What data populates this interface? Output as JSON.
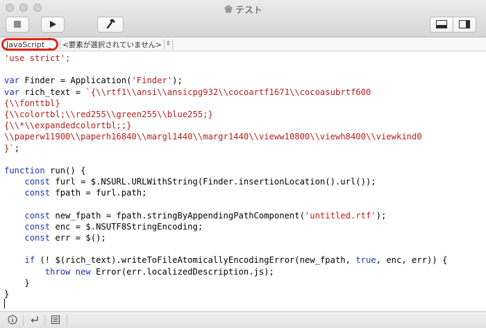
{
  "window": {
    "title": "テスト"
  },
  "navigator": {
    "language": "JavaScript",
    "element": "<要素が選択されていません>"
  },
  "colors": {
    "keyword": "#1b36b4",
    "string": "#b6201a",
    "highlight_ring": "#e2231a"
  },
  "toolbar": {
    "stop_icon": "stop-icon",
    "run_icon": "play-icon",
    "compile_icon": "hammer-icon",
    "view_icons": [
      "split-bottom-icon",
      "split-right-icon"
    ]
  },
  "bottombar": {
    "icons": [
      "info-icon",
      "return-icon",
      "list-icon"
    ]
  },
  "editor": {
    "lines": [
      [
        {
          "t": "'use strict';",
          "c": "str"
        }
      ],
      [],
      [
        {
          "t": "var",
          "c": "kw"
        },
        {
          "t": " Finder = Application("
        },
        {
          "t": "'Finder'",
          "c": "str"
        },
        {
          "t": ");"
        }
      ],
      [
        {
          "t": "var",
          "c": "kw"
        },
        {
          "t": " rich_text = "
        },
        {
          "t": "`{\\\\rtf1\\\\ansi\\\\ansicpg932\\\\cocoartf1671\\\\cocoasubrtf600",
          "c": "str"
        }
      ],
      [
        {
          "t": "{\\\\fonttbl}",
          "c": "str"
        }
      ],
      [
        {
          "t": "{\\\\colortbl;\\\\red255\\\\green255\\\\blue255;}",
          "c": "str"
        }
      ],
      [
        {
          "t": "{\\\\*\\\\expandedcolortbl;;}",
          "c": "str"
        }
      ],
      [
        {
          "t": "\\\\paperw11900\\\\paperh16840\\\\margl1440\\\\margr1440\\\\vieww10800\\\\viewh8400\\\\viewkind0",
          "c": "str"
        }
      ],
      [
        {
          "t": "}`",
          "c": "str"
        },
        {
          "t": ";"
        }
      ],
      [],
      [
        {
          "t": "function",
          "c": "kw"
        },
        {
          "t": " run() {"
        }
      ],
      [
        {
          "t": "    "
        },
        {
          "t": "const",
          "c": "kw"
        },
        {
          "t": " furl = $.NSURL.URLWithString(Finder.insertionLocation().url());"
        }
      ],
      [
        {
          "t": "    "
        },
        {
          "t": "const",
          "c": "kw"
        },
        {
          "t": " fpath = furl.path;"
        }
      ],
      [],
      [
        {
          "t": "    "
        },
        {
          "t": "const",
          "c": "kw"
        },
        {
          "t": " new_fpath = fpath.stringByAppendingPathComponent("
        },
        {
          "t": "'untitled.rtf'",
          "c": "str"
        },
        {
          "t": ");"
        }
      ],
      [
        {
          "t": "    "
        },
        {
          "t": "const",
          "c": "kw"
        },
        {
          "t": " enc = $.NSUTF8StringEncoding;"
        }
      ],
      [
        {
          "t": "    "
        },
        {
          "t": "const",
          "c": "kw"
        },
        {
          "t": " err = $();"
        }
      ],
      [],
      [
        {
          "t": "    "
        },
        {
          "t": "if",
          "c": "kw"
        },
        {
          "t": " (! $(rich_text).writeToFileAtomicallyEncodingError(new_fpath, "
        },
        {
          "t": "true",
          "c": "kw"
        },
        {
          "t": ", enc, err)) {"
        }
      ],
      [
        {
          "t": "        "
        },
        {
          "t": "throw new",
          "c": "kw"
        },
        {
          "t": " Error(err.localizedDescription.js);"
        }
      ],
      [
        {
          "t": "    }"
        }
      ],
      [
        {
          "t": "}"
        }
      ]
    ]
  }
}
